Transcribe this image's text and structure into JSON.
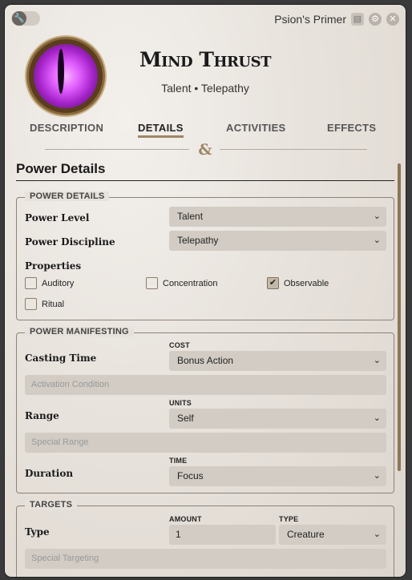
{
  "window": {
    "header_title": "Psion's Primer",
    "item_title": "Mind Thrust",
    "subtitle": "Talent • Telepathy",
    "icons": {
      "toggle": "wrench-icon",
      "doc": "journal-icon",
      "settings": "gear-icon",
      "close": "close-icon"
    },
    "toggle_glyph": "🔧",
    "doc_glyph": "▤",
    "gear_glyph": "⚙",
    "close_glyph": "✕"
  },
  "tabs": [
    {
      "label": "DESCRIPTION",
      "active": false
    },
    {
      "label": "DETAILS",
      "active": true
    },
    {
      "label": "ACTIVITIES",
      "active": false
    },
    {
      "label": "EFFECTS",
      "active": false
    }
  ],
  "divider_glyph": "&",
  "section": {
    "title": "Power Details"
  },
  "power_details": {
    "legend": "POWER DETAILS",
    "power_level_label": "Power Level",
    "power_level_value": "Talent",
    "discipline_label": "Power Discipline",
    "discipline_value": "Telepathy",
    "properties_label": "Properties",
    "properties": [
      {
        "label": "Auditory",
        "checked": false
      },
      {
        "label": "Concentration",
        "checked": false
      },
      {
        "label": "Observable",
        "checked": true
      },
      {
        "label": "Ritual",
        "checked": false
      }
    ],
    "check_glyph": "✔"
  },
  "power_manifesting": {
    "legend": "POWER MANIFESTING",
    "casting_time_label": "Casting Time",
    "cost_label": "COST",
    "cost_value": "Bonus Action",
    "activation_placeholder": "Activation Condition",
    "range_label": "Range",
    "units_label": "UNITS",
    "units_value": "Self",
    "special_range_placeholder": "Special Range",
    "duration_label": "Duration",
    "time_label": "TIME",
    "time_value": "Focus"
  },
  "targets": {
    "legend": "TARGETS",
    "type_label": "Type",
    "amount_label": "AMOUNT",
    "amount_value": "1",
    "type_header": "TYPE",
    "type_value": "Creature",
    "special_targeting_placeholder": "Special Targeting"
  },
  "chevron_glyph": "❯",
  "colors": {
    "accent": "#9d8666",
    "field_bg": "#d2ccc4",
    "border": "#8d8378"
  }
}
